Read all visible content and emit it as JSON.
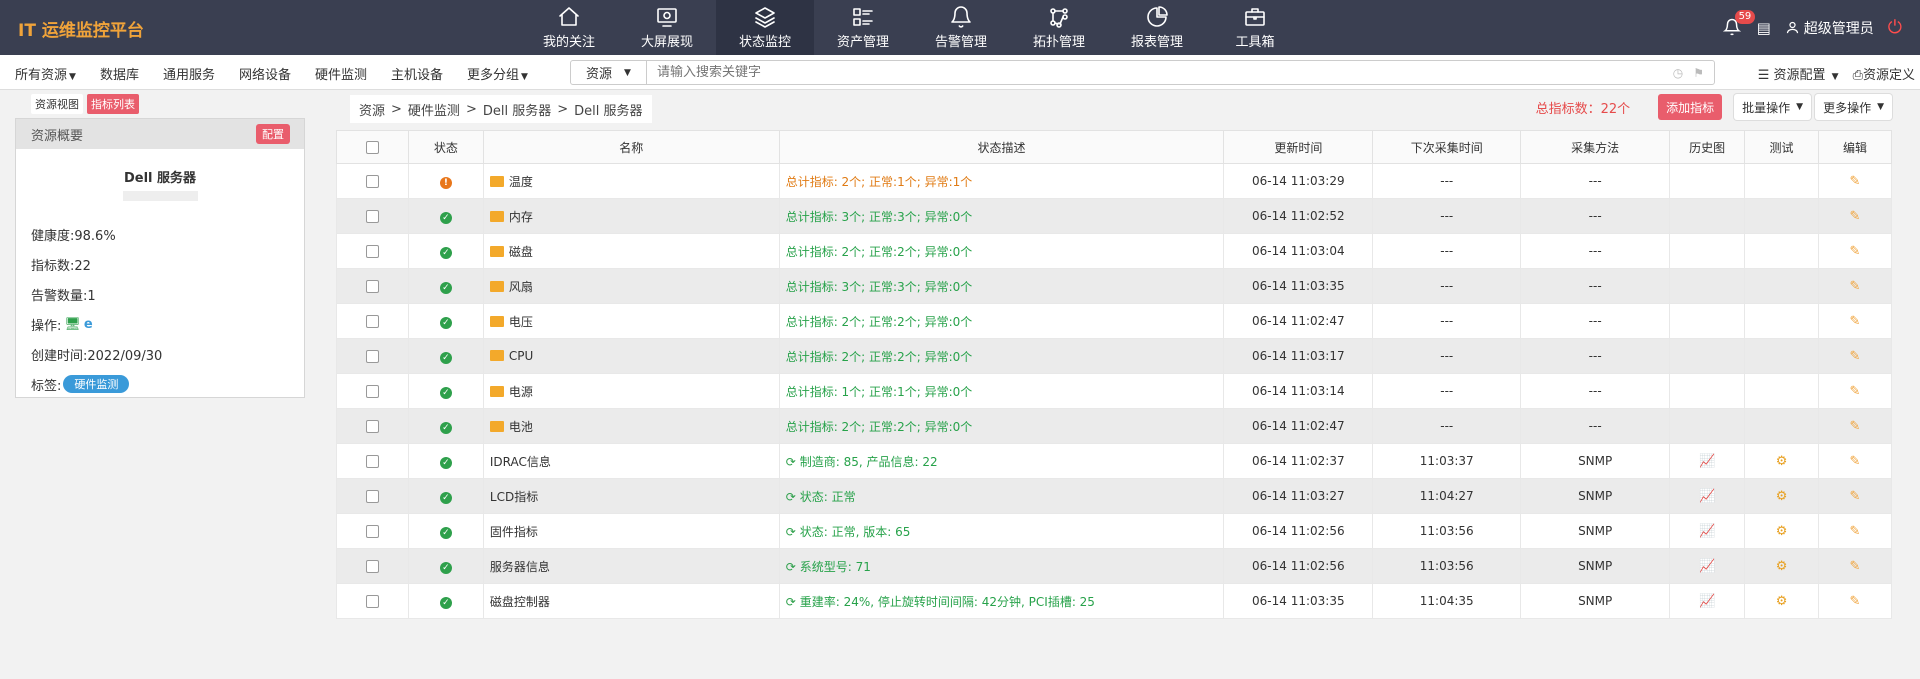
{
  "app": {
    "title": "IT 运维监控平台"
  },
  "nav": [
    {
      "label": "我的关注",
      "icon": "home-icon"
    },
    {
      "label": "大屏展现",
      "icon": "monitor-icon"
    },
    {
      "label": "状态监控",
      "icon": "layers-icon",
      "active": true
    },
    {
      "label": "资产管理",
      "icon": "list-icon"
    },
    {
      "label": "告警管理",
      "icon": "bell-icon"
    },
    {
      "label": "拓扑管理",
      "icon": "topology-icon"
    },
    {
      "label": "报表管理",
      "icon": "pie-chart-icon"
    },
    {
      "label": "工具箱",
      "icon": "toolbox-icon"
    }
  ],
  "header": {
    "notifications": "59",
    "user": "超级管理员"
  },
  "categories": [
    "所有资源",
    "数据库",
    "通用服务",
    "网络设备",
    "硬件监测",
    "主机设备",
    "更多分组"
  ],
  "search": {
    "type": "资源",
    "placeholder": "请输入搜索关键字"
  },
  "subright": {
    "config": "资源配置",
    "define": "资源定义"
  },
  "leftpanel": {
    "tabs": [
      "资源视图",
      "指标列表"
    ],
    "head": "资源概要",
    "config_btn": "配置",
    "title": "Dell 服务器",
    "health": "健康度:98.6%",
    "metrics": "指标数:22",
    "alerts": "告警数量:1",
    "ops": "操作:",
    "created": "创建时间:2022/09/30",
    "tag_label": "标签:",
    "tag": "硬件监测"
  },
  "breadcrumb": [
    "资源",
    "硬件监测",
    "Dell 服务器",
    "Dell 服务器"
  ],
  "actions": {
    "total": "总指标数：22个",
    "add": "添加指标",
    "batch": "批量操作",
    "more": "更多操作"
  },
  "table": {
    "headers": [
      "状态",
      "名称",
      "状态描述",
      "更新时间",
      "下次采集时间",
      "采集方法",
      "历史图",
      "测试",
      "编辑"
    ],
    "rows": [
      {
        "status": "warn",
        "folder": true,
        "name": "温度",
        "desc": "总计指标: 2个; 正常:1个; 异常:1个",
        "descType": "warn",
        "updated": "06-14 11:03:29",
        "next": "---",
        "method": "---",
        "hist": false,
        "test": false
      },
      {
        "status": "ok",
        "folder": true,
        "name": "内存",
        "desc": "总计指标: 3个; 正常:3个; 异常:0个",
        "descType": "ok",
        "updated": "06-14 11:02:52",
        "next": "---",
        "method": "---",
        "hist": false,
        "test": false
      },
      {
        "status": "ok",
        "folder": true,
        "name": "磁盘",
        "desc": "总计指标: 2个; 正常:2个; 异常:0个",
        "descType": "ok",
        "updated": "06-14 11:03:04",
        "next": "---",
        "method": "---",
        "hist": false,
        "test": false
      },
      {
        "status": "ok",
        "folder": true,
        "name": "风扇",
        "desc": "总计指标: 3个; 正常:3个; 异常:0个",
        "descType": "ok",
        "updated": "06-14 11:03:35",
        "next": "---",
        "method": "---",
        "hist": false,
        "test": false
      },
      {
        "status": "ok",
        "folder": true,
        "name": "电压",
        "desc": "总计指标: 2个; 正常:2个; 异常:0个",
        "descType": "ok",
        "updated": "06-14 11:02:47",
        "next": "---",
        "method": "---",
        "hist": false,
        "test": false
      },
      {
        "status": "ok",
        "folder": true,
        "name": "CPU",
        "desc": "总计指标: 2个; 正常:2个; 异常:0个",
        "descType": "ok",
        "updated": "06-14 11:03:17",
        "next": "---",
        "method": "---",
        "hist": false,
        "test": false
      },
      {
        "status": "ok",
        "folder": true,
        "name": "电源",
        "desc": "总计指标: 1个; 正常:1个; 异常:0个",
        "descType": "ok",
        "updated": "06-14 11:03:14",
        "next": "---",
        "method": "---",
        "hist": false,
        "test": false
      },
      {
        "status": "ok",
        "folder": true,
        "name": "电池",
        "desc": "总计指标: 2个; 正常:2个; 异常:0个",
        "descType": "ok",
        "updated": "06-14 11:02:47",
        "next": "---",
        "method": "---",
        "hist": false,
        "test": false
      },
      {
        "status": "ok",
        "folder": false,
        "name": "IDRAC信息",
        "desc": "制造商: 85, 产品信息: 22",
        "descType": "sync",
        "updated": "06-14 11:02:37",
        "next": "11:03:37",
        "method": "SNMP",
        "hist": true,
        "test": true
      },
      {
        "status": "ok",
        "folder": false,
        "name": "LCD指标",
        "desc": "状态: 正常",
        "descType": "sync",
        "updated": "06-14 11:03:27",
        "next": "11:04:27",
        "method": "SNMP",
        "hist": true,
        "test": true
      },
      {
        "status": "ok",
        "folder": false,
        "name": "固件指标",
        "desc": "状态: 正常, 版本: 65",
        "descType": "sync",
        "updated": "06-14 11:02:56",
        "next": "11:03:56",
        "method": "SNMP",
        "hist": true,
        "test": true
      },
      {
        "status": "ok",
        "folder": false,
        "name": "服务器信息",
        "desc": "系统型号: 71",
        "descType": "sync",
        "updated": "06-14 11:02:56",
        "next": "11:03:56",
        "method": "SNMP",
        "hist": true,
        "test": true
      },
      {
        "status": "ok",
        "folder": false,
        "name": "磁盘控制器",
        "desc": "重建率: 24%, 停止旋转时间间隔: 42分钟, PCI插槽: 25",
        "descType": "sync",
        "updated": "06-14 11:03:35",
        "next": "11:04:35",
        "method": "SNMP",
        "hist": true,
        "test": true
      }
    ]
  }
}
